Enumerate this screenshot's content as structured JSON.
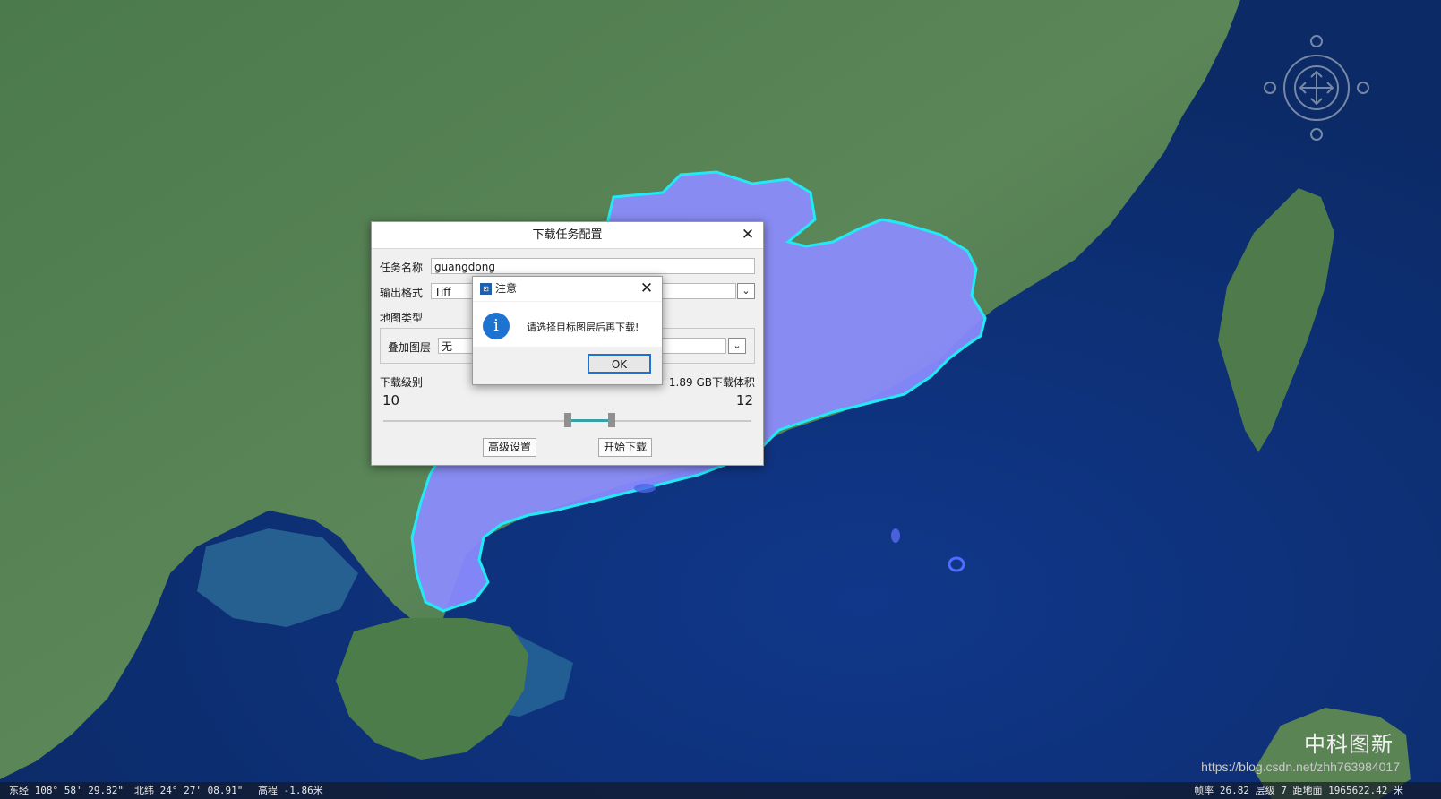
{
  "main_dialog": {
    "title": "下载任务配置",
    "task_name_label": "任务名称",
    "task_name_value": "guangdong",
    "output_format_label": "输出格式",
    "output_format_value": "Tiff",
    "map_type_label": "地图类型",
    "overlay_layer_label": "叠加图层",
    "overlay_layer_value": "无",
    "download_level_label": "下载级别",
    "size_info": "1.89 GB下载体积",
    "level_min": "10",
    "level_max": "12",
    "level_range_selected": [
      0.5,
      0.62
    ],
    "advanced_button": "高级设置",
    "start_button": "开始下载"
  },
  "alert_dialog": {
    "title": "注意",
    "message": "请选择目标图层后再下载!",
    "ok_button": "OK"
  },
  "status_bar": {
    "longitude": "东经 108° 58' 29.82\"",
    "latitude": "北纬 24° 27' 08.91\"",
    "elevation": "高程 -1.86米",
    "right_info": "帧率 26.82 层级 7 距地面 1965622.42 米"
  },
  "watermark": {
    "brand": "中科图新",
    "url": "https://blog.csdn.net/zhh763984017"
  },
  "colors": {
    "region_fill": "#8c8cff",
    "region_outline": "#22eaf5",
    "info_icon": "#1e73d0"
  }
}
